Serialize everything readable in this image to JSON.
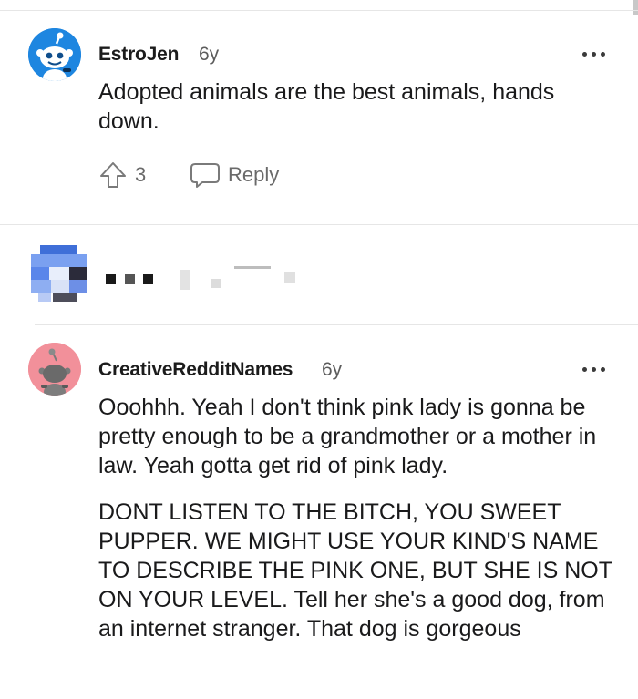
{
  "comments": [
    {
      "username": "EstroJen",
      "age": "6y",
      "body": "Adopted animals are the best animals, hands down.",
      "upvotes": "3",
      "reply_label": "Reply",
      "avatar_icon": "snoo-avatar-blue-icon",
      "avatar_color": "#1e86e0"
    },
    {
      "username": "CreativeRedditNames",
      "age": "6y",
      "body_paragraphs": [
        "Ooohhh. Yeah I don't think pink lady is gonna be pretty enough to be a grandmother or a mother in law. Yeah gotta get rid of pink lady.",
        "DONT LISTEN TO THE BITCH, YOU SWEET PUPPER. WE MIGHT USE YOUR KIND'S NAME TO DESCRIBE THE PINK ONE, BUT SHE IS NOT ON YOUR LEVEL. Tell her she's a good dog, from an internet stranger. That dog is gorgeous"
      ],
      "avatar_icon": "snoo-avatar-pink-icon",
      "avatar_color": "#f2909a"
    }
  ],
  "colors": {
    "text": "#1a1a1b",
    "muted": "#5c5c5c",
    "divider": "#e6e6e6"
  }
}
